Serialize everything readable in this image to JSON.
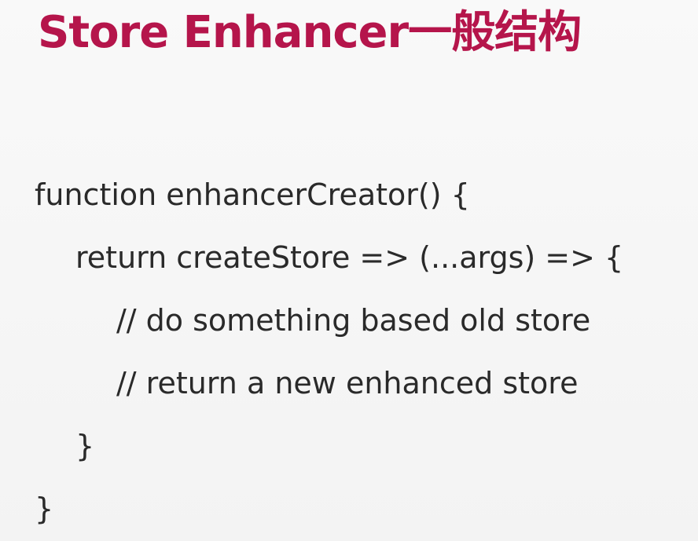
{
  "slide": {
    "title": "Store Enhancer一般结构",
    "code_lines": [
      "function enhancerCreator() {",
      "return createStore => (...args) => {",
      "// do something based old store",
      "// return a new enhanced store",
      "}",
      "}"
    ]
  },
  "colors": {
    "title": "#b5154b",
    "text": "#2a2a2a",
    "background": "#f7f7f7"
  }
}
